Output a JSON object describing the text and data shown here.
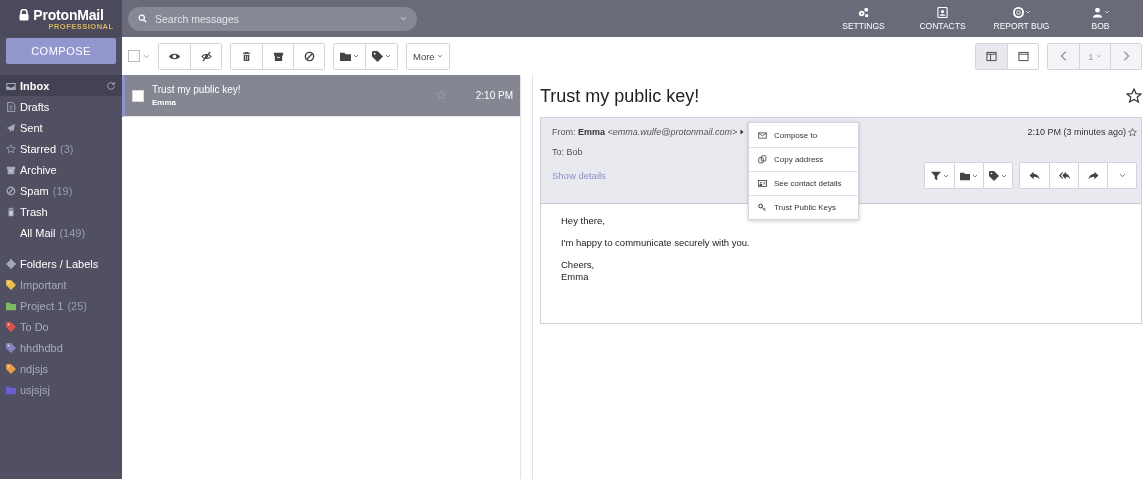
{
  "logo": {
    "name": "ProtonMail",
    "edition": "PROFESSIONAL"
  },
  "search": {
    "placeholder": "Search messages"
  },
  "nav": [
    {
      "kind": "settings",
      "label": "SETTINGS",
      "dropdown": false
    },
    {
      "kind": "contacts",
      "label": "CONTACTS",
      "dropdown": false
    },
    {
      "kind": "bug",
      "label": "REPORT BUG",
      "dropdown": true
    },
    {
      "kind": "user",
      "label": "BOB",
      "dropdown": true
    }
  ],
  "sidebar": {
    "compose": "COMPOSE",
    "folders": [
      {
        "kind": "inbox",
        "label": "Inbox",
        "selected": true
      },
      {
        "kind": "drafts",
        "label": "Drafts",
        "selected": false
      },
      {
        "kind": "sent",
        "label": "Sent",
        "selected": false
      },
      {
        "kind": "starred",
        "label": "Starred",
        "count": "(3)",
        "selected": false
      },
      {
        "kind": "archive",
        "label": "Archive",
        "selected": false
      },
      {
        "kind": "spam",
        "label": "Spam",
        "count": "(19)",
        "selected": false
      },
      {
        "kind": "trash",
        "label": "Trash",
        "selected": false
      },
      {
        "kind": "all",
        "label": "All Mail",
        "count": "(149)",
        "selected": false
      }
    ],
    "labels_heading": "Folders / Labels",
    "labels": [
      {
        "kind": "tag",
        "label": "Important",
        "color": "#e9be4c"
      },
      {
        "kind": "folder",
        "label": "Project 1",
        "count": "(25)",
        "color": "#7dbb63"
      },
      {
        "kind": "tag",
        "label": "To Do",
        "color": "#d2574e"
      },
      {
        "kind": "tag",
        "label": "hhdhdbd",
        "color": "#8585c0"
      },
      {
        "kind": "tag",
        "label": "ndjsjs",
        "color": "#e39c49"
      },
      {
        "kind": "folder",
        "label": "usjsjsj",
        "color": "#6c5fd6"
      }
    ]
  },
  "toolbar": {
    "select_all_checked": false,
    "more": "More",
    "view_modes": [
      {
        "selected": true
      },
      {
        "selected": false
      }
    ],
    "page": "1"
  },
  "messages": [
    {
      "subject": "Trust my public key!",
      "sender": "Emma",
      "time": "2:10 PM",
      "selected": true,
      "checked": false,
      "starred": false
    }
  ],
  "reader": {
    "subject": "Trust my public key!",
    "starred": false,
    "from_label": "From:",
    "from_name": "Emma",
    "from_email": "<emma.wulfe@protonmail.com>",
    "to": "To: Bob",
    "time": "2:10 PM (3 minutes ago)",
    "message_starred": false,
    "show_details": "Show details",
    "body": [
      "Hey there,",
      "I'm happy to communicate securely with you.",
      "Cheers,\nEmma"
    ],
    "context_menu": [
      {
        "kind": "compose",
        "label": "Compose to"
      },
      {
        "kind": "copy",
        "label": "Copy address"
      },
      {
        "kind": "contact",
        "label": "See contact details"
      },
      {
        "kind": "key",
        "label": "Trust Public Keys"
      }
    ]
  }
}
